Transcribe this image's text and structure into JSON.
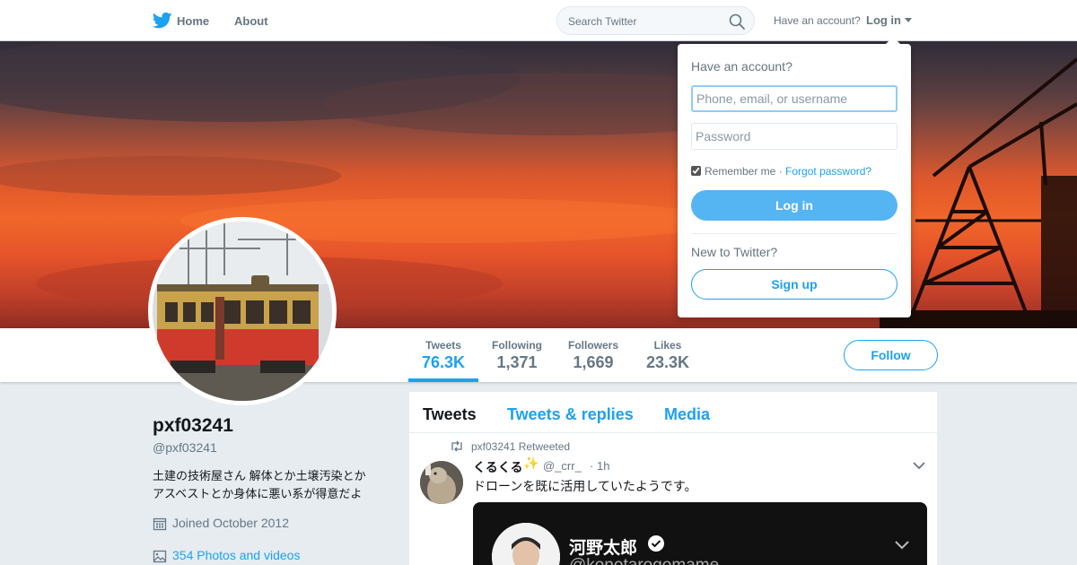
{
  "nav": {
    "brand_icon": "twitter-bird-icon",
    "home_label": "Home",
    "about_label": "About",
    "search_placeholder": "Search Twitter",
    "search_icon": "search-icon",
    "have_account": "Have an account?",
    "login_label": "Log in"
  },
  "profile": {
    "name": "pxf03241",
    "handle": "@pxf03241",
    "bio_line1": "土建の技術屋さん 解体とか土壌汚染とか",
    "bio_line2": "アスベストとか身体に悪い系が得意だよ",
    "joined": "Joined October 2012",
    "photos": "354 Photos and videos",
    "follow_label": "Follow"
  },
  "stats": [
    {
      "label": "Tweets",
      "value": "76.3K",
      "active": true
    },
    {
      "label": "Following",
      "value": "1,371",
      "active": false
    },
    {
      "label": "Followers",
      "value": "1,669",
      "active": false
    },
    {
      "label": "Likes",
      "value": "23.3K",
      "active": false
    }
  ],
  "timeline": {
    "tabs": [
      {
        "label": "Tweets",
        "active": true
      },
      {
        "label": "Tweets & replies",
        "active": false
      },
      {
        "label": "Media",
        "active": false
      }
    ],
    "tweet": {
      "retweet_text": "pxf03241 Retweeted",
      "author_name": "くるくる",
      "author_emoji": "✨",
      "author_handle": "@_crr_",
      "separator": "·",
      "time": "1h",
      "text": "ドローンを既に活用していたようです。",
      "embed_name": "河野太郎",
      "embed_handle": "@konotarogomame"
    }
  },
  "login_dropdown": {
    "title": "Have an account?",
    "username_placeholder": "Phone, email, or username",
    "password_placeholder": "Password",
    "remember_label": "Remember me",
    "separator": "·",
    "forgot_label": "Forgot password?",
    "login_button": "Log in",
    "new_label": "New to Twitter?",
    "signup_button": "Sign up"
  },
  "colors": {
    "accent": "#1da1f2",
    "background": "#e6ecf0",
    "login_button": "#55b4f2"
  }
}
